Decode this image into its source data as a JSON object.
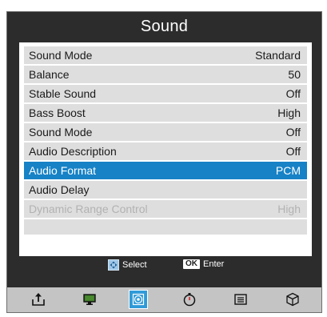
{
  "menu": {
    "title": "Sound",
    "items": [
      {
        "label": "Sound Mode",
        "value": "Standard"
      },
      {
        "label": "Balance",
        "value": "50"
      },
      {
        "label": "Stable Sound",
        "value": "Off"
      },
      {
        "label": "Bass Boost",
        "value": "High"
      },
      {
        "label": "Sound Mode",
        "value": "Off"
      },
      {
        "label": "Audio Description",
        "value": "Off"
      },
      {
        "label": "Audio Format",
        "value": "PCM"
      },
      {
        "label": "Audio Delay",
        "value": ""
      },
      {
        "label": "Dynamic Range Control",
        "value": "High"
      }
    ],
    "selected_index": 6,
    "disabled_index": 8
  },
  "hints": {
    "select_label": "Select",
    "ok_badge": "OK",
    "enter_label": "Enter"
  },
  "icon_bar": {
    "icons": [
      "export-icon",
      "monitor-icon",
      "sound-icon",
      "timer-icon",
      "settings-list-icon",
      "cube-icon"
    ],
    "active_icon": "sound-icon"
  },
  "colors": {
    "panel_bg": "#2c2c2c",
    "row_bg": "#dedede",
    "selected_bg": "#1782c6",
    "disabled_text": "#b2b2b2",
    "icon_bar_bg": "#c4c4c4"
  }
}
